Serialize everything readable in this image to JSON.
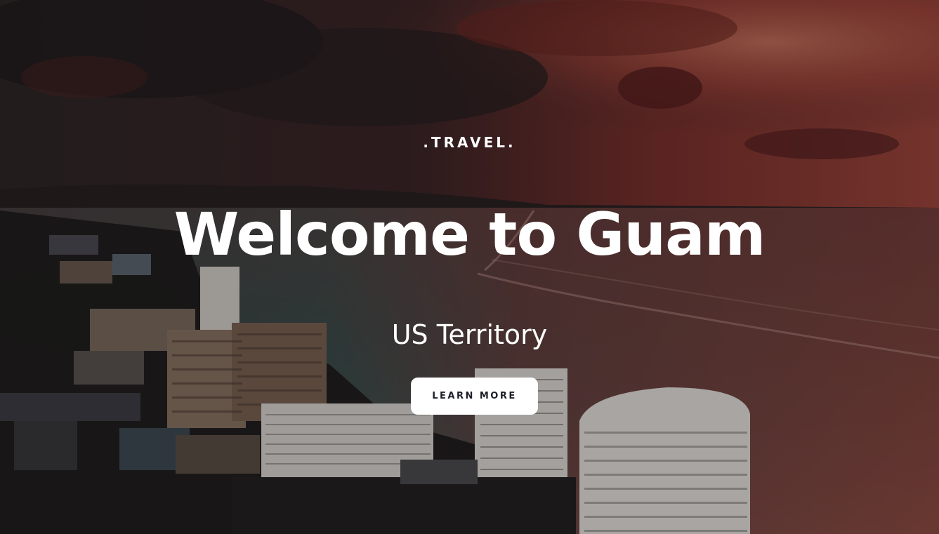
{
  "hero": {
    "eyebrow": ".TRAVEL.",
    "title": "Welcome to Guam",
    "subtitle": "US Territory",
    "cta_label": "LEARN MORE",
    "background_alt": "Aerial view of Tumon Bay hotels and coastline at sunset"
  },
  "colors": {
    "text": "#ffffff",
    "button_bg": "#ffffff",
    "button_text": "#1e1e2a",
    "sky_red": "#a83a32",
    "sea_teal": "#2f6b6a"
  }
}
